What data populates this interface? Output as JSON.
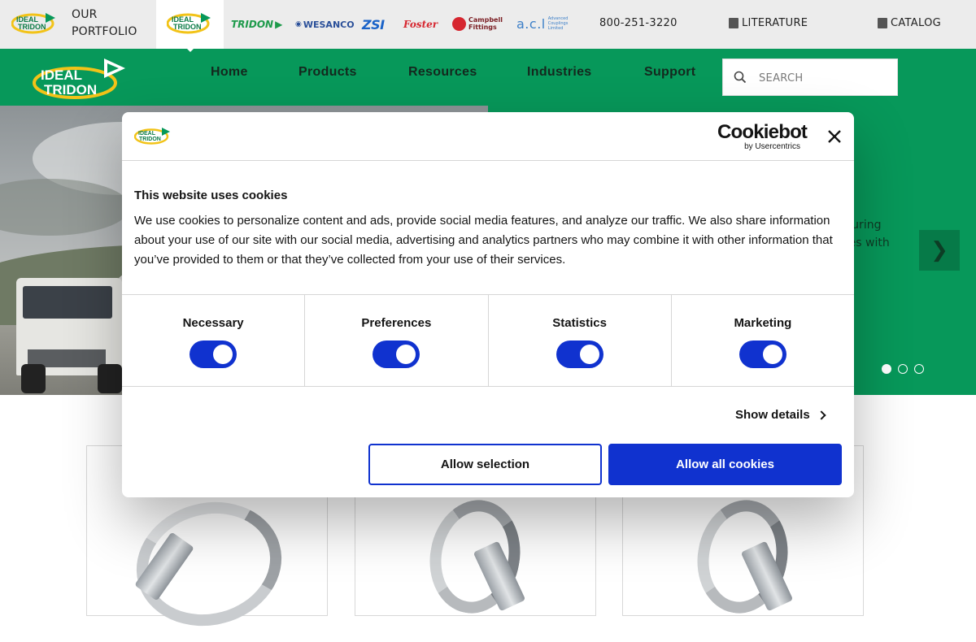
{
  "topbar": {
    "portfolio_label": "OUR PORTFOLIO",
    "brands": [
      "TRIDON",
      "WESANCO",
      "ZSI",
      "Foster",
      "Campbell Fittings",
      "a.c.l",
      "Advanced Couplings Limited"
    ],
    "phone": "800-251-3220",
    "literature_label": "LITERATURE",
    "catalog_label": "CATALOG"
  },
  "nav": {
    "items": [
      "Home",
      "Products",
      "Resources",
      "Industries",
      "Support"
    ],
    "search_placeholder": "SEARCH"
  },
  "hero": {
    "text_fragment": "cturing\nries with",
    "next_label": "❯",
    "slides": 3,
    "active_slide": 1
  },
  "cookie_dialog": {
    "brand_name": "Cookiebot",
    "brand_by": "by Usercentrics",
    "title": "This website uses cookies",
    "body": "We use cookies to personalize content and ads, provide social media features, and analyze our traffic. We also share information about your use of our site with our social media, advertising and analytics partners who may combine it with other information that you’ve provided to them or that they’ve collected from your use of their services.",
    "categories": [
      {
        "label": "Necessary",
        "enabled": true
      },
      {
        "label": "Preferences",
        "enabled": true
      },
      {
        "label": "Statistics",
        "enabled": true
      },
      {
        "label": "Marketing",
        "enabled": true
      }
    ],
    "show_details": "Show details",
    "allow_selection": "Allow selection",
    "allow_all": "Allow all cookies"
  },
  "colors": {
    "brand_green": "#07985a",
    "cookie_blue": "#1032cf",
    "logo_yellow": "#f2c318"
  }
}
